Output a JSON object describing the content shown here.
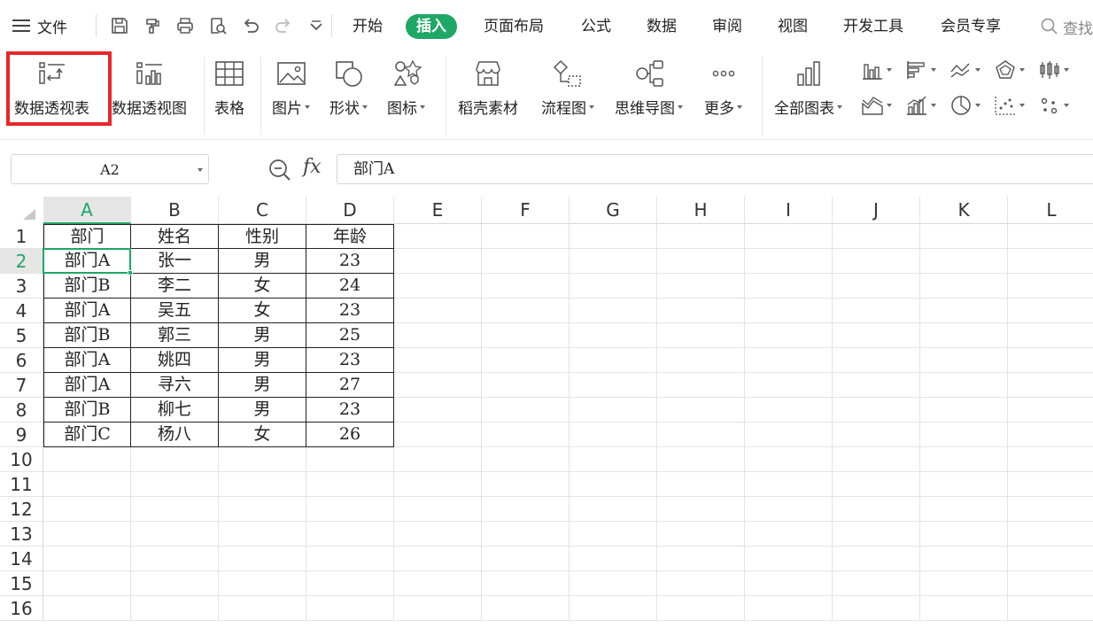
{
  "menu": {
    "file_label": "文件",
    "tabs": [
      "开始",
      "插入",
      "页面布局",
      "公式",
      "数据",
      "审阅",
      "视图",
      "开发工具",
      "会员专享"
    ],
    "active_tab": "插入",
    "search_label": "查找"
  },
  "ribbon": {
    "pivot_table": "数据透视表",
    "pivot_chart": "数据透视图",
    "table": "表格",
    "picture": "图片",
    "shape": "形状",
    "icon": "图标",
    "docer": "稻壳素材",
    "flowchart": "流程图",
    "mindmap": "思维导图",
    "more": "更多",
    "all_charts": "全部图表"
  },
  "formula_bar": {
    "name_box": "A2",
    "fx": "fx",
    "content": "部门A"
  },
  "sheet": {
    "columns": [
      "A",
      "B",
      "C",
      "D",
      "E",
      "F",
      "G",
      "H",
      "I",
      "J",
      "K",
      "L"
    ],
    "rows": [
      "1",
      "2",
      "3",
      "4",
      "5",
      "6",
      "7",
      "8",
      "9",
      "10",
      "11",
      "12",
      "13",
      "14",
      "15",
      "16"
    ],
    "selected_col": "A",
    "selected_row": "2",
    "data": [
      [
        "部门",
        "姓名",
        "性别",
        "年龄"
      ],
      [
        "部门A",
        "张一",
        "男",
        "23"
      ],
      [
        "部门B",
        "李二",
        "女",
        "24"
      ],
      [
        "部门A",
        "吴五",
        "女",
        "23"
      ],
      [
        "部门B",
        "郭三",
        "男",
        "25"
      ],
      [
        "部门A",
        "姚四",
        "男",
        "23"
      ],
      [
        "部门A",
        "寻六",
        "男",
        "27"
      ],
      [
        "部门B",
        "柳七",
        "男",
        "23"
      ],
      [
        "部门C",
        "杨八",
        "女",
        "26"
      ]
    ]
  },
  "colors": {
    "accent": "#1fa766",
    "highlight": "#e8262b"
  }
}
